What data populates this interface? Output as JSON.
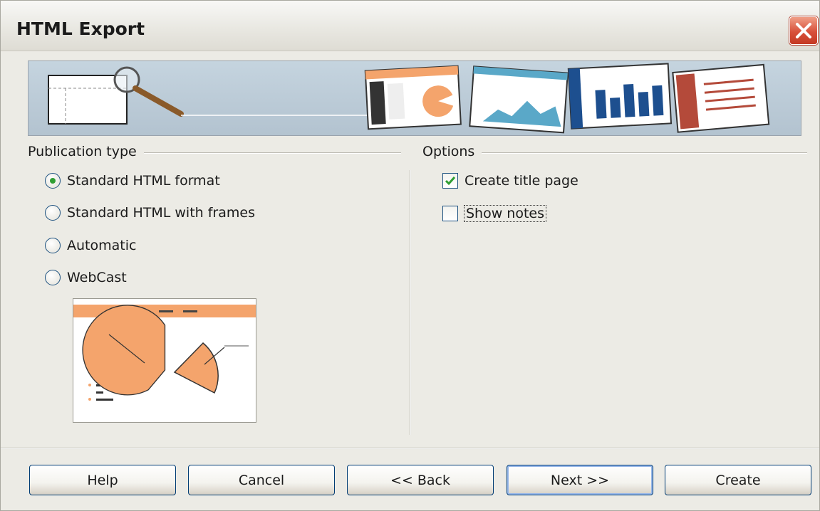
{
  "window": {
    "title": "HTML Export",
    "close_icon": "close-icon"
  },
  "publication": {
    "group_label": "Publication type",
    "options": [
      {
        "label": "Standard HTML format",
        "selected": true
      },
      {
        "label": "Standard HTML with frames",
        "selected": false
      },
      {
        "label": "Automatic",
        "selected": false
      },
      {
        "label": "WebCast",
        "selected": false
      }
    ]
  },
  "options": {
    "group_label": "Options",
    "create_title_page": {
      "label": "Create title page",
      "checked": true
    },
    "show_notes": {
      "label": "Show notes",
      "checked": false
    }
  },
  "buttons": {
    "help": "Help",
    "cancel": "Cancel",
    "back": "<< Back",
    "next": "Next >>",
    "create": "Create"
  },
  "colors": {
    "accent_orange": "#f4a46c",
    "check_green": "#2f9e33",
    "close_red": "#d8503a",
    "chart_blue": "#1d4f8f",
    "chart_teal": "#5aa8c8"
  }
}
